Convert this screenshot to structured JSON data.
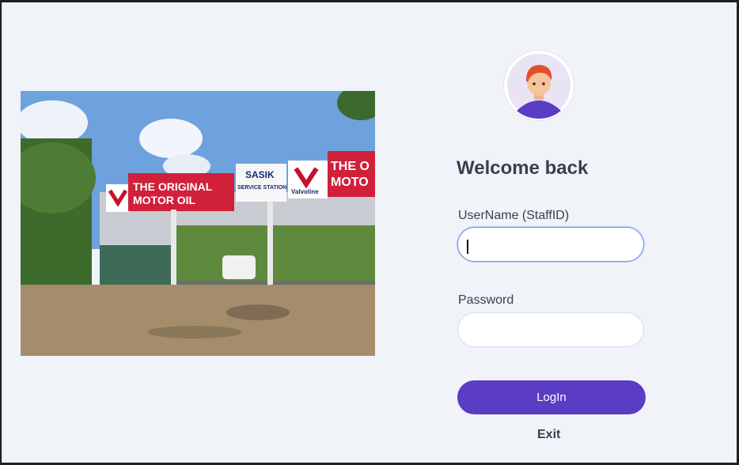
{
  "login": {
    "title": "Welcome back",
    "username_label": "UserName (StaffID)",
    "username_value": "",
    "password_label": "Password",
    "password_value": "",
    "login_button": "LogIn",
    "exit_link": "Exit"
  },
  "photo": {
    "sign_left_line1": "THE ORIGINAL",
    "sign_left_line2": "MOTOR OIL",
    "sign_center_line1": "SASIK",
    "sign_center_line2": "SERVICE STATION",
    "brand": "Valvoline",
    "sign_right_line1": "THE O",
    "sign_right_line2": "MOTO"
  },
  "icons": {
    "avatar": "user-avatar-icon"
  },
  "colors": {
    "background": "#f0f3f8",
    "primary_button": "#5b3cc4",
    "focus_border": "#6f9be8",
    "text": "#3d3d4f"
  }
}
